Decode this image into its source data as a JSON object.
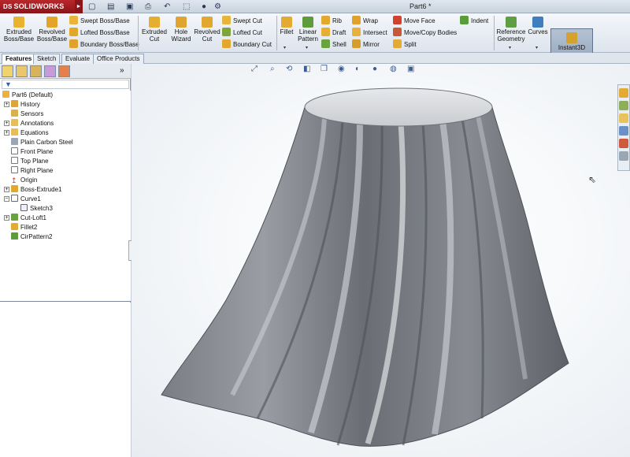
{
  "app": {
    "brand": "SOLIDWORKS",
    "brand_mark": "DS",
    "document_title": "Part6 *"
  },
  "quick_access": {
    "icons": [
      "new-icon",
      "open-icon",
      "save-icon",
      "print-icon",
      "undo-icon",
      "select-icon",
      "rebuild-icon",
      "options-icon"
    ]
  },
  "ribbon": {
    "extruded_boss": "Extruded Boss/Base",
    "revolved_boss": "Revolved Boss/Base",
    "swept_boss": "Swept Boss/Base",
    "lofted_boss": "Lofted Boss/Base",
    "boundary_boss": "Boundary Boss/Base",
    "extruded_cut": "Extruded Cut",
    "hole_wizard": "Hole Wizard",
    "revolved_cut": "Revolved Cut",
    "swept_cut": "Swept Cut",
    "lofted_cut": "Lofted Cut",
    "boundary_cut": "Boundary Cut",
    "fillet": "Fillet",
    "linear_pattern": "Linear Pattern",
    "rib": "Rib",
    "draft": "Draft",
    "shell": "Shell",
    "wrap": "Wrap",
    "intersect": "Intersect",
    "mirror": "Mirror",
    "move_face": "Move Face",
    "move_copy": "Move/Copy Bodies",
    "split": "Split",
    "indent": "Indent",
    "reference_geometry": "Reference Geometry",
    "curves": "Curves",
    "instant3d": "Instant3D"
  },
  "tabs": [
    "Features",
    "Sketch",
    "Evaluate",
    "Office Products"
  ],
  "active_tab": "Features",
  "feature_tree": {
    "root": "Part6  (Default)",
    "items": [
      {
        "label": "History",
        "icon": "history-icon",
        "expandable": true
      },
      {
        "label": "Sensors",
        "icon": "sensors-icon",
        "expandable": false
      },
      {
        "label": "Annotations",
        "icon": "annotations-icon",
        "expandable": true
      },
      {
        "label": "Equations",
        "icon": "equations-icon",
        "expandable": true
      },
      {
        "label": "Plain Carbon Steel",
        "icon": "material-icon",
        "expandable": false
      },
      {
        "label": "Front Plane",
        "icon": "plane-icon",
        "expandable": false
      },
      {
        "label": "Top Plane",
        "icon": "plane-icon",
        "expandable": false
      },
      {
        "label": "Right Plane",
        "icon": "plane-icon",
        "expandable": false
      },
      {
        "label": "Origin",
        "icon": "origin-icon",
        "expandable": false
      },
      {
        "label": "Boss-Extrude1",
        "icon": "extrude-icon",
        "expandable": true
      },
      {
        "label": "Curve1",
        "icon": "curve-icon",
        "expandable": true
      },
      {
        "label": "Sketch3",
        "icon": "sketch-icon",
        "expandable": false
      },
      {
        "label": "Cut-Loft1",
        "icon": "cut-loft-icon",
        "expandable": true
      },
      {
        "label": "Fillet2",
        "icon": "fillet-icon",
        "expandable": false
      },
      {
        "label": "CirPattern2",
        "icon": "circular-pattern-icon",
        "expandable": false
      }
    ]
  },
  "colors": {
    "accent": "#b8272b",
    "model_body": "#6e7178",
    "model_top": "#d7d9dc",
    "ribbon_bg": "#e9eef4"
  }
}
